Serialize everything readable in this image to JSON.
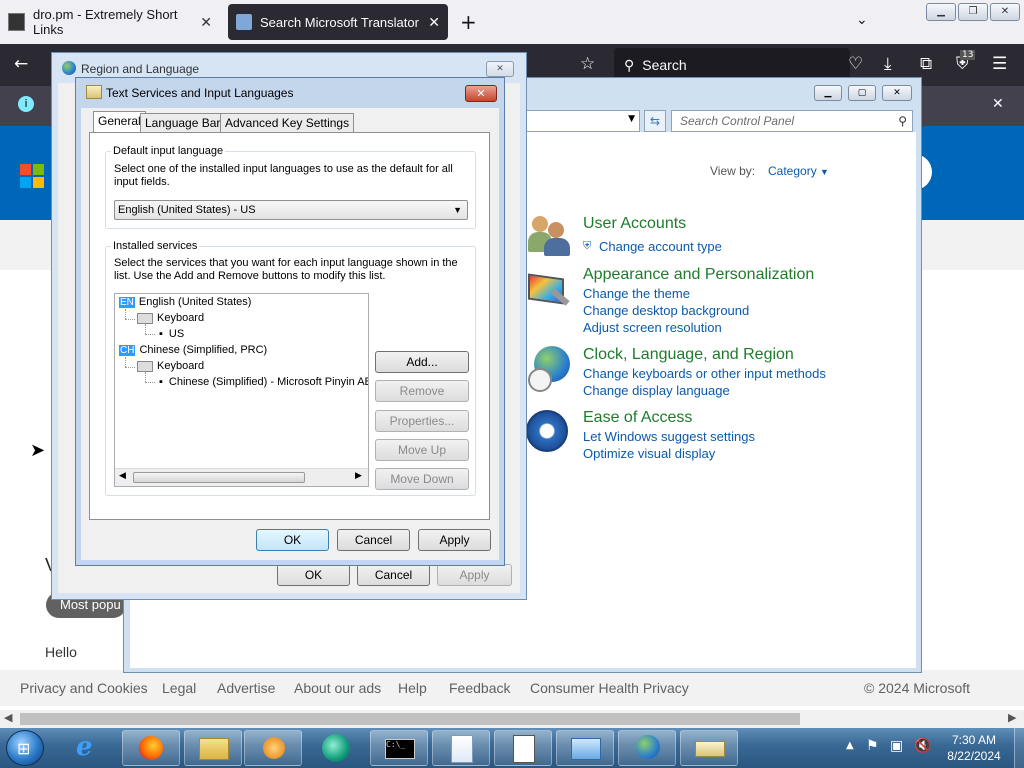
{
  "browser": {
    "tabs": [
      {
        "title": "dro.pm - Extremely Short Links",
        "active": false
      },
      {
        "title": "Search Microsoft Translator",
        "active": true
      }
    ],
    "new_tab_icon": "plus-icon",
    "search_placeholder": "Search"
  },
  "webpage": {
    "partial_texts": {
      "most_popular": "Most popu",
      "hello": "Hello",
      "letter_v": "V"
    },
    "footer_links": [
      "Privacy and Cookies",
      "Legal",
      "Advertise",
      "About our ads",
      "Help",
      "Feedback",
      "Consumer Health Privacy"
    ],
    "copyright": "© 2024 Microsoft"
  },
  "control_panel": {
    "search_placeholder": "Search Control Panel",
    "view_by_label": "View by:",
    "view_by_value": "Category",
    "categories": [
      {
        "title": "User Accounts",
        "links": [
          "Change account type"
        ]
      },
      {
        "title": "Appearance and Personalization",
        "links": [
          "Change the theme",
          "Change desktop background",
          "Adjust screen resolution"
        ]
      },
      {
        "title": "Clock, Language, and Region",
        "links": [
          "Change keyboards or other input methods",
          "Change display language"
        ]
      },
      {
        "title": "Ease of Access",
        "links": [
          "Let Windows suggest settings",
          "Optimize visual display"
        ]
      }
    ]
  },
  "region_dialog": {
    "title": "Region and Language",
    "buttons": {
      "ok": "OK",
      "cancel": "Cancel",
      "apply": "Apply"
    }
  },
  "text_services_dialog": {
    "title": "Text Services and Input Languages",
    "tabs": [
      "General",
      "Language Bar",
      "Advanced Key Settings"
    ],
    "default_group": {
      "label": "Default input language",
      "description": "Select one of the installed input languages to use as the default for all input fields.",
      "selected": "English (United States) - US"
    },
    "installed_group": {
      "label": "Installed services",
      "description": "Select the services that you want for each input language shown in the list. Use the Add and Remove buttons to modify this list.",
      "tree": [
        {
          "code": "EN",
          "language": "English (United States)",
          "category": "Keyboard",
          "item": "US"
        },
        {
          "code": "CH",
          "language": "Chinese (Simplified, PRC)",
          "category": "Keyboard",
          "item": "Chinese (Simplified) - Microsoft Pinyin ABC"
        }
      ],
      "buttons": {
        "add": "Add...",
        "remove": "Remove",
        "properties": "Properties...",
        "move_up": "Move Up",
        "move_down": "Move Down"
      }
    },
    "footer_buttons": {
      "ok": "OK",
      "cancel": "Cancel",
      "apply": "Apply"
    }
  },
  "taskbar": {
    "clock_time": "7:30 AM",
    "clock_date": "8/22/2024",
    "firefox_badge": "13"
  }
}
